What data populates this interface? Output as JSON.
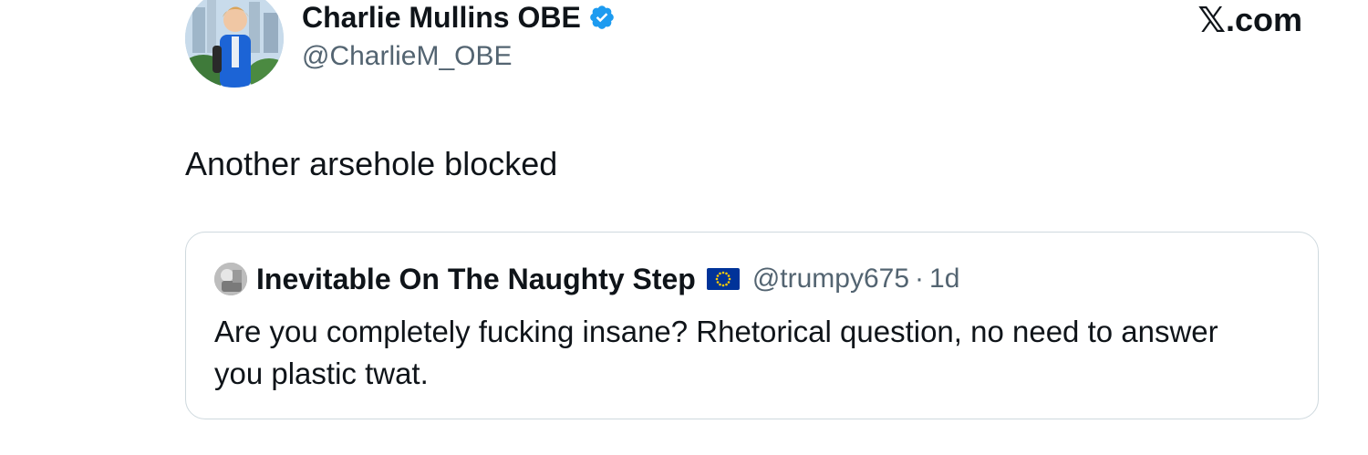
{
  "author": {
    "display_name": "Charlie Mullins OBE",
    "handle": "@CharlieM_OBE",
    "verified_icon": "verified-badge-icon",
    "avatar_icon": "profile-photo"
  },
  "brand": {
    "label": ".com",
    "mark": "𝕏"
  },
  "tweet": {
    "text": "Another arsehole blocked"
  },
  "quote": {
    "display_name": "Inevitable On The Naughty Step",
    "flag_icon": "eu-flag-icon",
    "handle": "@trumpy675",
    "separator": "·",
    "time": "1d",
    "text_line1": "Are you completely fucking insane? Rhetorical question, no need to answer",
    "text_line2": "you plastic twat."
  },
  "colors": {
    "verified": "#1d9bf0",
    "secondary_text": "#536471",
    "border": "#cfd9de",
    "eu_blue": "#003399",
    "eu_gold": "#ffcc00"
  }
}
